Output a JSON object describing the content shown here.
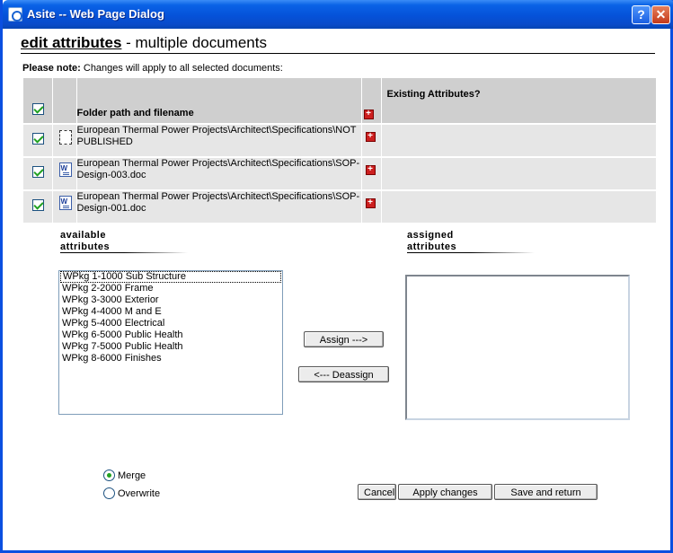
{
  "window": {
    "title": "Asite -- Web Page Dialog",
    "help_label": "?",
    "close_label": "✕"
  },
  "header": {
    "title_strong": "edit attributes",
    "title_rest": " - multiple documents"
  },
  "note": {
    "label": "Please note:",
    "text": " Changes will apply to all selected documents:"
  },
  "table": {
    "col_path": "Folder path and filename",
    "col_existing": "Existing Attributes?",
    "rows": [
      {
        "path": "European Thermal Power Projects\\Architect\\Specifications\\NOT PUBLISHED",
        "icon": "unpublished-doc-icon"
      },
      {
        "path": "European Thermal Power Projects\\Architect\\Specifications\\SOP-Design-003.doc",
        "icon": "word-doc-icon"
      },
      {
        "path": "European Thermal Power Projects\\Architect\\Specifications\\SOP-Design-001.doc",
        "icon": "word-doc-icon"
      }
    ]
  },
  "available": {
    "label_line1": "available",
    "label_line2": "attributes",
    "items": [
      "WPkg 1-1000 Sub Structure",
      "WPkg 2-2000 Frame",
      "WPkg 3-3000 Exterior",
      "WPkg 4-4000 M and E",
      "WPkg 5-4000 Electrical",
      "WPkg 6-5000 Public Health",
      "WPkg 7-5000 Public Health",
      "WPkg 8-6000 Finishes"
    ]
  },
  "assigned": {
    "label_line1": "assigned",
    "label_line2": "attributes",
    "items": []
  },
  "actions": {
    "assign": "Assign --->",
    "deassign": "<--- Deassign",
    "cancel": "Cancel",
    "apply": "Apply changes",
    "save": "Save and return"
  },
  "mode": {
    "merge": "Merge",
    "overwrite": "Overwrite",
    "selected": "Merge"
  },
  "colors": {
    "title_bar": "#0552d9",
    "table_header": "#cfcfcf",
    "table_row": "#e6e6e6",
    "check": "#21a121",
    "plus": "#cc1f1f"
  }
}
